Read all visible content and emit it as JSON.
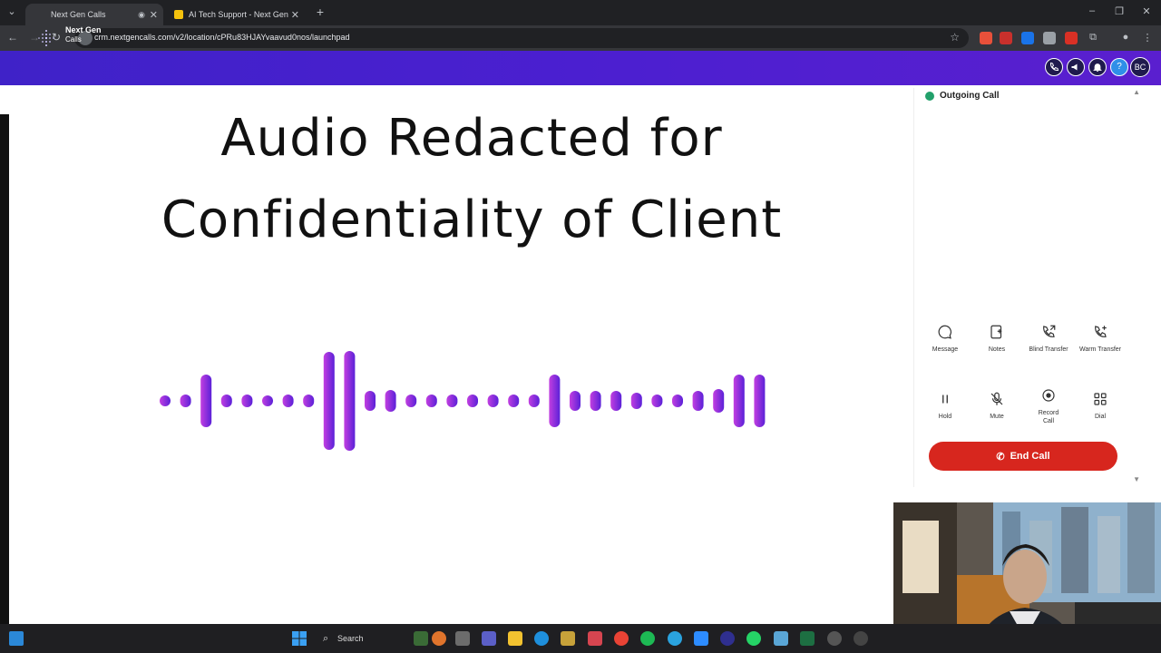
{
  "browser": {
    "tabs": [
      {
        "title": "Next Gen Calls",
        "active": true
      },
      {
        "title": "AI Tech Support - Next Gen Cal",
        "active": false
      }
    ],
    "new_tab": "+",
    "url": "crm.nextgencalls.com/v2/location/cPRu83HJAYvaavud0nos/launchpad"
  },
  "app": {
    "logo_line1": "Next Gen",
    "logo_line2": "Calls",
    "header_buttons": [
      {
        "icon": "phone-icon"
      },
      {
        "icon": "megaphone-icon"
      },
      {
        "icon": "bell-icon"
      },
      {
        "icon": "help-icon",
        "label": "?"
      },
      {
        "icon": "avatar",
        "label": "BC"
      }
    ],
    "brand_color": "#4b1fd0"
  },
  "overlay": {
    "headline_line1": "Audio Redacted for",
    "headline_line2": "Confidentiality of Client",
    "waveform_colors": [
      "#c23fe0",
      "#5b21d8"
    ]
  },
  "call_panel": {
    "status": "Outgoing Call",
    "controls_row1": [
      {
        "icon": "message-icon",
        "label": "Message"
      },
      {
        "icon": "notes-icon",
        "label": "Notes"
      },
      {
        "icon": "blind-transfer-icon",
        "label": "Blind Transfer"
      },
      {
        "icon": "warm-transfer-icon",
        "label": "Warm Transfer"
      }
    ],
    "controls_row2": [
      {
        "icon": "pause-icon",
        "label": "Hold"
      },
      {
        "icon": "mic-off-icon",
        "label": "Mute"
      },
      {
        "icon": "record-icon",
        "label": "Record Call"
      },
      {
        "icon": "dialpad-icon",
        "label": "Dial"
      }
    ],
    "end_call_label": "End Call",
    "end_call_color": "#d7261e"
  },
  "taskbar": {
    "search_label": "Search"
  }
}
